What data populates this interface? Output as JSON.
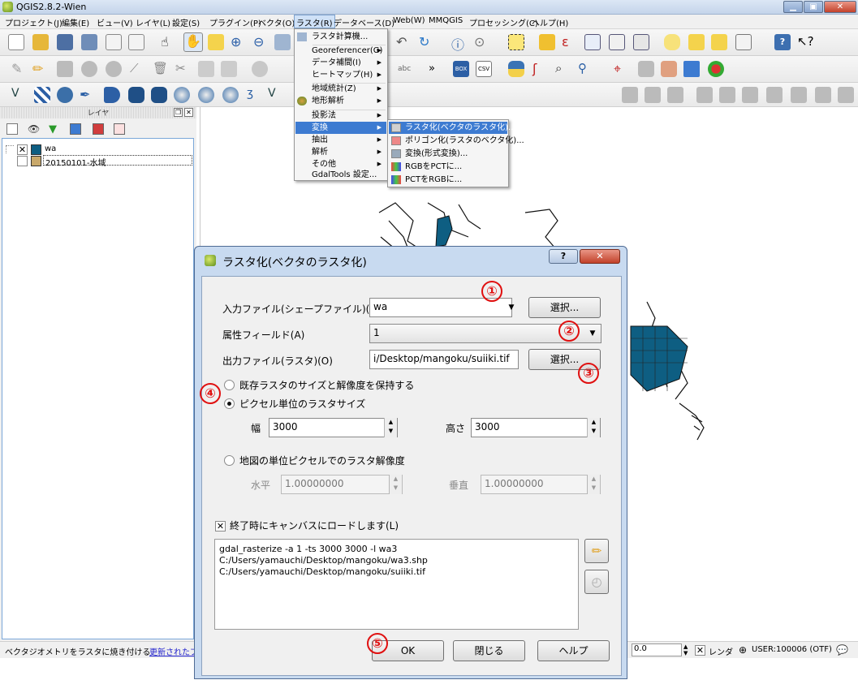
{
  "window": {
    "title": "QGIS2.8.2-Wien"
  },
  "menubar": {
    "items": [
      "プロジェクト(J)",
      "編集(E)",
      "ビュー(V)",
      "レイヤ(L)",
      "設定(S)",
      "プラグイン(P)",
      "ベクタ(O)",
      "ラスタ(R)",
      "データベース(D)",
      "Web(W)",
      "MMQGIS",
      "プロセッシング(C)",
      "ヘルプ(H)"
    ]
  },
  "raster_menu": {
    "items": [
      "ラスタ計算機...",
      "Georeferencer(G)",
      "データ補間(I)",
      "ヒートマップ(H)",
      "地域統計(Z)",
      "地形解析",
      "投影法",
      "変換",
      "抽出",
      "解析",
      "その他",
      "GdalTools 設定..."
    ]
  },
  "convert_submenu": {
    "items": [
      "ラスタ化(ベクタのラスタ化)...",
      "ポリゴン化(ラスタのベクタ化)...",
      "変換(形式変換)...",
      "RGBをPCTに...",
      "PCTをRGBに..."
    ]
  },
  "layer_panel": {
    "title": "レイヤ",
    "layers": [
      {
        "name": "wa",
        "color": "#0e5e82",
        "checked": true
      },
      {
        "name": "20150101-水域",
        "color": "#c8a86a",
        "checked": false
      }
    ]
  },
  "toolbar_text": {
    "more": "»",
    "ctx_badge": "BOX",
    "csv_badge": "CSV"
  },
  "dialog": {
    "title": "ラスタ化(ベクタのラスタ化)",
    "help_btn": "?",
    "close_btn": "✕",
    "input_label": "入力ファイル(シェープファイル)(I)",
    "input_value": "wa",
    "select_btn": "選択...",
    "attr_label": "属性フィールド(A)",
    "attr_value": "1",
    "output_label": "出力ファイル(ラスタ)(O)",
    "output_value": "i/Desktop/mangoku/suiiki.tif",
    "output_select_btn": "選択...",
    "opt_keep": "既存ラスタのサイズと解像度を保持する",
    "opt_pixel": "ピクセル単位のラスタサイズ",
    "width_label": "幅",
    "width_value": "3000",
    "height_label": "高さ",
    "height_value": "3000",
    "opt_map": "地図の単位ピクセルでのラスタ解像度",
    "horiz_label": "水平",
    "horiz_value": "1.00000000",
    "vert_label": "垂直",
    "vert_value": "1.00000000",
    "load_label": "終了時にキャンバスにロードします(L)",
    "command_lines": [
      "gdal_rasterize -a 1 -ts 3000 3000 -l wa3",
      "C:/Users/yamauchi/Desktop/mangoku/wa3.shp",
      "C:/Users/yamauchi/Desktop/mangoku/suiiki.tif"
    ],
    "ok_btn": "OK",
    "close_label": "閉じる",
    "help_label": "ヘルプ"
  },
  "annotations": [
    "①",
    "②",
    "③",
    "④",
    "⑤"
  ],
  "status": {
    "message": "ベクタジオメトリをラスタに焼き付ける",
    "link": "更新されたプラ",
    "rotation": "0.0",
    "render_label": "レンダ",
    "crs": "USER:100006 (OTF)"
  },
  "colors": {
    "water": "#0e5e82",
    "selection": "#3d7bd1",
    "annotation": "#e01010"
  }
}
